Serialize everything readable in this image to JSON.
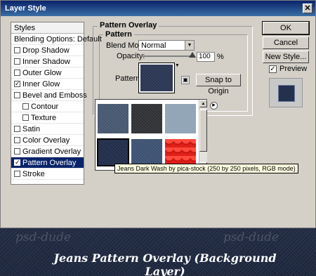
{
  "window": {
    "title": "Layer Style",
    "close": "✕"
  },
  "styles": {
    "header": "Styles",
    "items": [
      {
        "label": "Blending Options: Default",
        "checkbox": false,
        "checked": false,
        "indent": false,
        "selected": false
      },
      {
        "label": "Drop Shadow",
        "checkbox": true,
        "checked": false,
        "indent": false,
        "selected": false
      },
      {
        "label": "Inner Shadow",
        "checkbox": true,
        "checked": false,
        "indent": false,
        "selected": false
      },
      {
        "label": "Outer Glow",
        "checkbox": true,
        "checked": false,
        "indent": false,
        "selected": false
      },
      {
        "label": "Inner Glow",
        "checkbox": true,
        "checked": true,
        "indent": false,
        "selected": false
      },
      {
        "label": "Bevel and Emboss",
        "checkbox": true,
        "checked": false,
        "indent": false,
        "selected": false
      },
      {
        "label": "Contour",
        "checkbox": true,
        "checked": false,
        "indent": true,
        "selected": false
      },
      {
        "label": "Texture",
        "checkbox": true,
        "checked": false,
        "indent": true,
        "selected": false
      },
      {
        "label": "Satin",
        "checkbox": true,
        "checked": false,
        "indent": false,
        "selected": false
      },
      {
        "label": "Color Overlay",
        "checkbox": true,
        "checked": false,
        "indent": false,
        "selected": false
      },
      {
        "label": "Gradient Overlay",
        "checkbox": true,
        "checked": false,
        "indent": false,
        "selected": false
      },
      {
        "label": "Pattern Overlay",
        "checkbox": true,
        "checked": true,
        "indent": false,
        "selected": true
      },
      {
        "label": "Stroke",
        "checkbox": true,
        "checked": false,
        "indent": false,
        "selected": false
      }
    ]
  },
  "panel": {
    "title": "Pattern Overlay",
    "section": "Pattern",
    "blend_mode_label": "Blend Mode:",
    "blend_mode_value": "Normal",
    "opacity_label": "Opacity:",
    "opacity_value": "100",
    "opacity_unit": "%",
    "pattern_label": "Pattern:",
    "snap_button": "Snap to Origin"
  },
  "buttons": {
    "ok": "OK",
    "cancel": "Cancel",
    "new_style": "New Style...",
    "preview": "Preview"
  },
  "preview_checked": true,
  "tooltip": "Jeans Dark Wash by pica-stock (250 by 250 pixels, RGB mode)",
  "watermark": "psd-dude",
  "caption": "Jeans Pattern Overlay (Background Layer)",
  "colors": {
    "selection": "#0a246a",
    "patterns": [
      "#44566e",
      "#2e2f33",
      "#8fa3b6",
      "#1f2b48",
      "#3b5070",
      "#e0201a"
    ]
  }
}
